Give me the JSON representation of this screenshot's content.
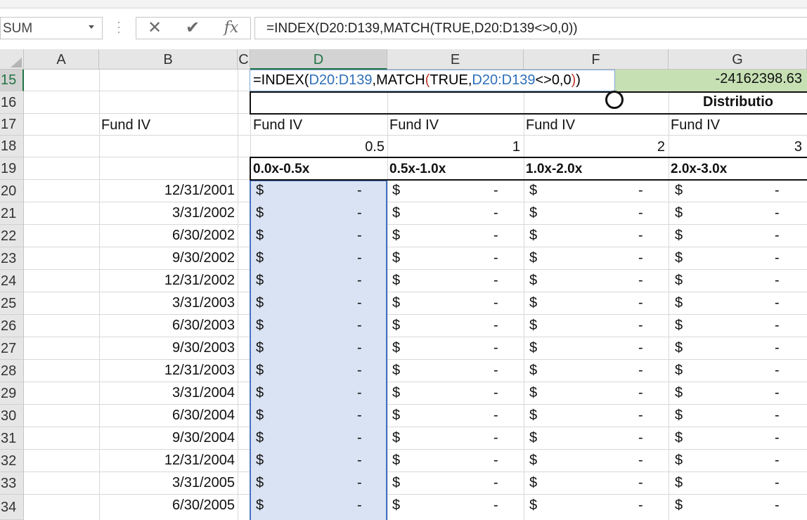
{
  "formula_bar": {
    "name_box": "SUM",
    "formula": "=INDEX(D20:D139,MATCH(TRUE,D20:D139<>0,0))",
    "icons": [
      "grip-dots-icon",
      "cancel-x-icon",
      "enter-check-icon",
      "insert-function-icon"
    ]
  },
  "columns": [
    "A",
    "B",
    "C",
    "D",
    "E",
    "F",
    "G"
  ],
  "selected_column": "D",
  "rows": [
    "15",
    "16",
    "17",
    "18",
    "19",
    "20",
    "21",
    "22",
    "23",
    "24",
    "25",
    "26",
    "27",
    "28",
    "29",
    "30",
    "31",
    "32",
    "33",
    "34"
  ],
  "selected_row": "15",
  "editing": {
    "parts": [
      {
        "text": "=INDEX(",
        "color": "#111111"
      },
      {
        "text": "D20:D139",
        "color": "#2e6fb8"
      },
      {
        "text": ",MATCH",
        "color": "#111111"
      },
      {
        "text": "(",
        "color": "#c0392b"
      },
      {
        "text": "TRUE,",
        "color": "#111111"
      },
      {
        "text": "D20:D139",
        "color": "#2e6fb8"
      },
      {
        "text": "<>0,0",
        "color": "#111111"
      },
      {
        "text": ")",
        "color": "#c0392b"
      },
      {
        "text": ")",
        "color": "#111111"
      }
    ]
  },
  "g15_value": "-24162398.63",
  "row16_label": "Distributio",
  "row17": {
    "b": "Fund IV",
    "d": "Fund IV",
    "e": "Fund IV",
    "f": "Fund IV",
    "g": "Fund IV"
  },
  "row18": {
    "d": "0.5",
    "e": "1",
    "f": "2",
    "g": "3"
  },
  "row19": {
    "d": "0.0x-0.5x",
    "e": "0.5x-1.0x",
    "f": "1.0x-2.0x",
    "g": "2.0x-3.0x"
  },
  "dates": [
    "12/31/2001",
    "3/31/2002",
    "6/30/2002",
    "9/30/2002",
    "12/31/2002",
    "3/31/2003",
    "6/30/2003",
    "9/30/2003",
    "12/31/2003",
    "3/31/2004",
    "6/30/2004",
    "9/30/2004",
    "12/31/2004",
    "3/31/2005",
    "6/30/2005"
  ],
  "currency_symbol": "$",
  "dash": "-",
  "colors": {
    "accent_green": "#217346",
    "edit_fill": "#c6e0b4",
    "selection": "#dae3f3",
    "selection_border": "#4472c4"
  }
}
